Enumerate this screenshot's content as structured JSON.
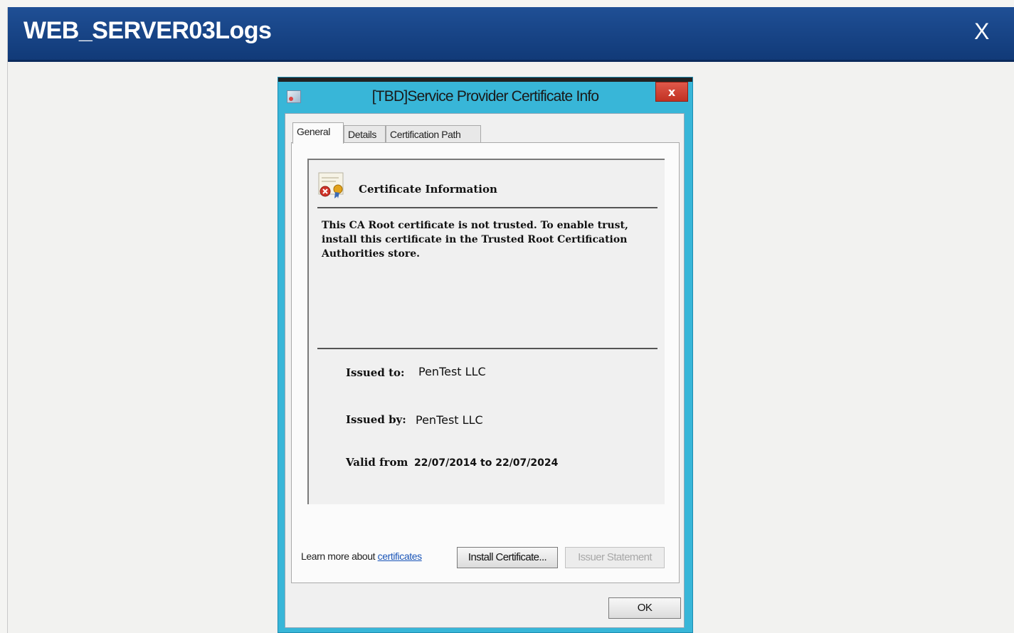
{
  "window": {
    "title": "WEB_SERVER03Logs",
    "close_label": "X"
  },
  "dialog": {
    "title": "[TBD]Service Provider Certificate Info",
    "close_label": "x",
    "tabs": [
      {
        "label": "General"
      },
      {
        "label": "Details"
      },
      {
        "label": "Certification Path"
      }
    ],
    "heading": "Certificate Information",
    "message": "This CA Root certificate is not trusted. To enable trust, install this certificate in the Trusted Root Certification Authorities store.",
    "fields": {
      "issued_to_label": "Issued to:",
      "issued_to_value": "PenTest LLC",
      "issued_by_label": "Issued by:",
      "issued_by_value": "PenTest LLC",
      "valid_label": "Valid from",
      "valid_value": "22/07/2014 to 22/07/2024"
    },
    "buttons": {
      "install": "Install Certificate...",
      "issuer_statement": "Issuer Statement",
      "ok": "OK"
    },
    "learn_more": {
      "prefix": "Learn more about ",
      "link": "certificates"
    }
  },
  "colors": {
    "titlebar": "#1a4688",
    "dialog_frame": "#38b6d8",
    "close_button": "#c9392a",
    "link": "#1a55b8"
  },
  "icons": [
    "close-icon",
    "certificate-error-icon",
    "app-icon"
  ]
}
